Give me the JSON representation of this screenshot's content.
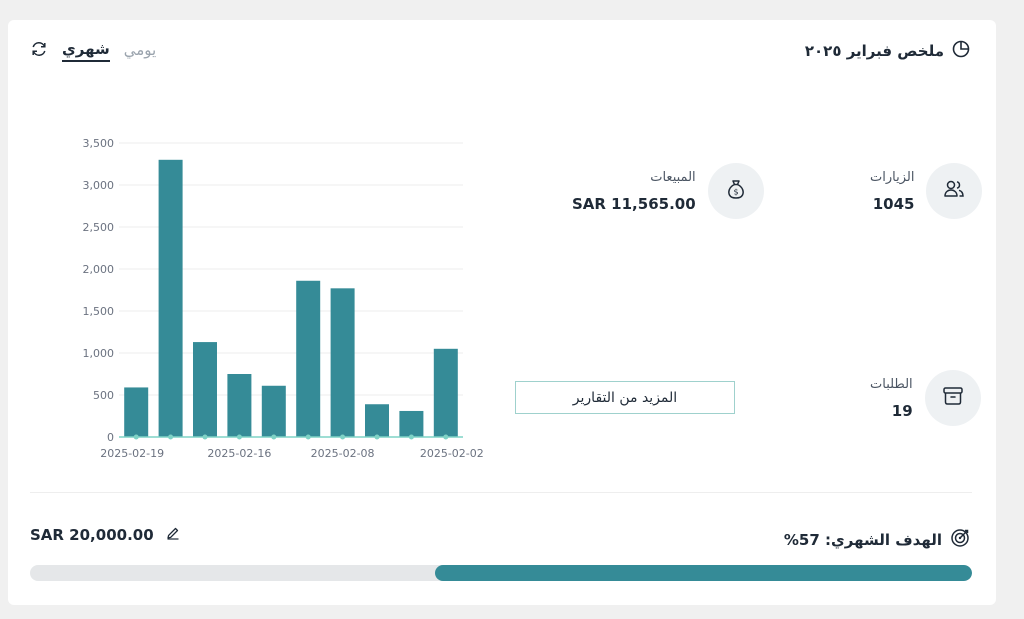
{
  "header": {
    "title": "ملخص فبراير ٢٠٢٥",
    "tabs": [
      {
        "label": "شهري",
        "active": true
      },
      {
        "label": "يومي",
        "active": false
      }
    ]
  },
  "stats": {
    "visits": {
      "label": "الزيارات",
      "value": "1045",
      "icon": "users-icon"
    },
    "sales": {
      "label": "المبيعات",
      "value": "SAR 11,565.00",
      "icon": "money-bag-icon"
    },
    "orders": {
      "label": "الطلبات",
      "value": "19",
      "icon": "archive-box-icon"
    }
  },
  "more_reports_label": "المزيد من التقارير",
  "goal": {
    "label": "الهدف الشهري: 57%",
    "amount": "SAR 20,000.00",
    "progress_fraction": 0.57
  },
  "colors": {
    "bar": "#358b97",
    "line": "#7fd3c6",
    "progress": "#358b97",
    "track": "#e5e7e9"
  },
  "chart_data": {
    "type": "bar",
    "categories": [
      "2025-02-19",
      "",
      "",
      "2025-02-16",
      "",
      "",
      "2025-02-08",
      "",
      "",
      "2025-02-02"
    ],
    "x_tick_labels": [
      "2025-02-19",
      "2025-02-16",
      "2025-02-08",
      "2025-02-02"
    ],
    "values": [
      590,
      3300,
      1130,
      750,
      610,
      1860,
      1770,
      390,
      310,
      1050
    ],
    "y_ticks": [
      "0",
      "500",
      "1,000",
      "1,500",
      "2,000",
      "2,500",
      "3,000",
      "3,500"
    ],
    "ylim": [
      0,
      3500
    ],
    "grid": true
  }
}
